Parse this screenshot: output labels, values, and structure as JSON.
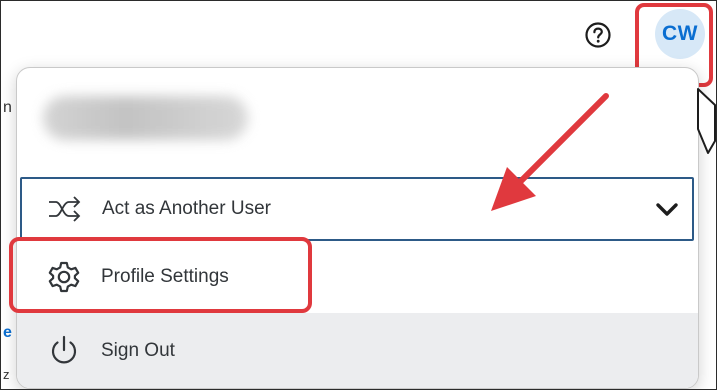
{
  "header": {
    "avatar_initials": "CW",
    "help_icon": "help-circle-icon"
  },
  "dropdown": {
    "user_name": "",
    "items": [
      {
        "label": "Act as Another User",
        "icon": "shuffle-icon",
        "expandable": true
      },
      {
        "label": "Profile Settings",
        "icon": "gear-icon"
      },
      {
        "label": "Sign Out",
        "icon": "power-icon"
      }
    ]
  },
  "background_fragments": [
    "n",
    "e",
    "z"
  ],
  "colors": {
    "accent": "#0a6ed1",
    "avatar_bg": "#d7e8f7",
    "highlight": "#e0393e",
    "selected_border": "#2d5a87",
    "signout_bg": "#ecedef"
  }
}
